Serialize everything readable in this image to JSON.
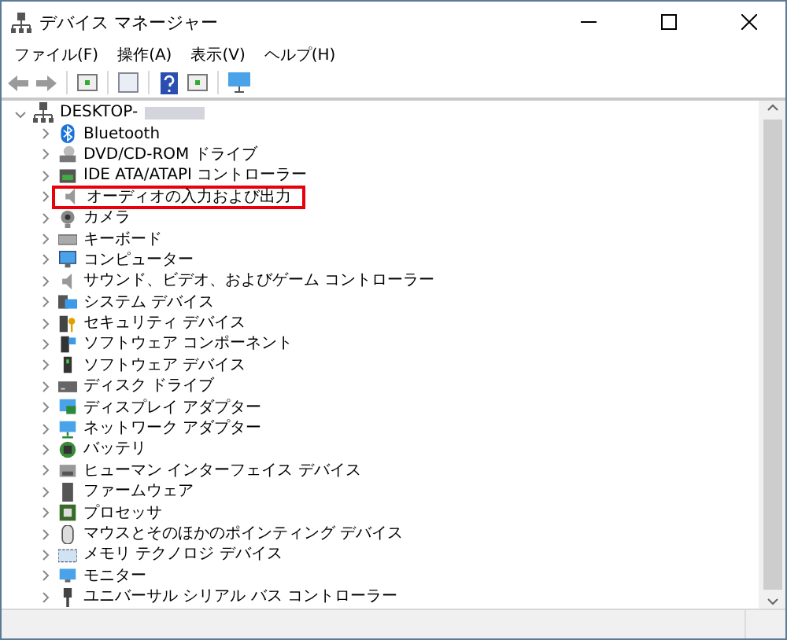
{
  "window": {
    "title": "デバイス マネージャー"
  },
  "menu": [
    {
      "label": "ファイル(F)"
    },
    {
      "label": "操作(A)"
    },
    {
      "label": "表示(V)"
    },
    {
      "label": "ヘルプ(H)"
    }
  ],
  "tree": {
    "root": {
      "label": "DESKTOP-",
      "expanded": true,
      "children": [
        {
          "label": "Bluetooth",
          "highlighted": false
        },
        {
          "label": "DVD/CD-ROM ドライブ",
          "highlighted": false
        },
        {
          "label": "IDE ATA/ATAPI コントローラー",
          "highlighted": false
        },
        {
          "label": "オーディオの入力および出力",
          "highlighted": true
        },
        {
          "label": "カメラ",
          "highlighted": false
        },
        {
          "label": "キーボード",
          "highlighted": false
        },
        {
          "label": "コンピューター",
          "highlighted": false
        },
        {
          "label": "サウンド、ビデオ、およびゲーム コントローラー",
          "highlighted": false
        },
        {
          "label": "システム デバイス",
          "highlighted": false
        },
        {
          "label": "セキュリティ デバイス",
          "highlighted": false
        },
        {
          "label": "ソフトウェア コンポーネント",
          "highlighted": false
        },
        {
          "label": "ソフトウェア デバイス",
          "highlighted": false
        },
        {
          "label": "ディスク ドライブ",
          "highlighted": false
        },
        {
          "label": "ディスプレイ アダプター",
          "highlighted": false
        },
        {
          "label": "ネットワーク アダプター",
          "highlighted": false
        },
        {
          "label": "バッテリ",
          "highlighted": false
        },
        {
          "label": "ヒューマン インターフェイス デバイス",
          "highlighted": false
        },
        {
          "label": "ファームウェア",
          "highlighted": false
        },
        {
          "label": "プロセッサ",
          "highlighted": false
        },
        {
          "label": "マウスとそのほかのポインティング デバイス",
          "highlighted": false
        },
        {
          "label": "メモリ テクノロジ デバイス",
          "highlighted": false
        },
        {
          "label": "モニター",
          "highlighted": false
        },
        {
          "label": "ユニバーサル シリアル バス コントローラー",
          "highlighted": false
        }
      ]
    }
  }
}
